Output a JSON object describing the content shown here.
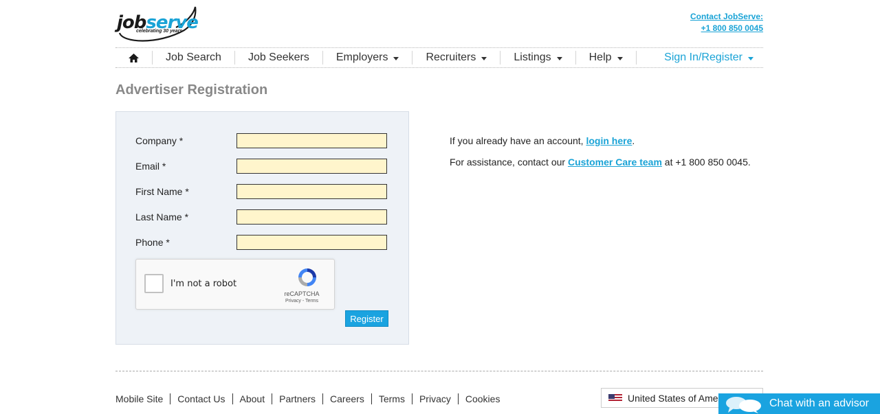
{
  "header": {
    "logo_word_1": "job",
    "logo_word_2": "serve",
    "logo_tagline": "celebrating 30 years",
    "contact_label": "Contact JobServe:",
    "contact_phone": "+1 800 850 0045"
  },
  "nav": {
    "home_icon": "home-icon",
    "items": [
      {
        "label": "Job Search",
        "dropdown": false
      },
      {
        "label": "Job Seekers",
        "dropdown": false
      },
      {
        "label": "Employers",
        "dropdown": true
      },
      {
        "label": "Recruiters",
        "dropdown": true
      },
      {
        "label": "Listings",
        "dropdown": true
      },
      {
        "label": "Help",
        "dropdown": true
      }
    ],
    "signin_label": "Sign In/Register"
  },
  "page": {
    "title": "Advertiser Registration"
  },
  "form": {
    "fields": [
      {
        "label": "Company *",
        "value": ""
      },
      {
        "label": "Email *",
        "value": ""
      },
      {
        "label": "First Name *",
        "value": ""
      },
      {
        "label": "Last Name *",
        "value": ""
      },
      {
        "label": "Phone *",
        "value": ""
      }
    ],
    "captcha_label": "I'm not a robot",
    "captcha_brand": "reCAPTCHA",
    "captcha_links": "Privacy - Terms",
    "register_label": "Register"
  },
  "info": {
    "line1_prefix": "If you already have an account, ",
    "line1_link": "login here",
    "line1_suffix": ".",
    "line2_prefix": "For assistance, contact our ",
    "line2_link": "Customer Care team",
    "line2_suffix": " at +1 800 850 0045."
  },
  "footer": {
    "links": [
      "Mobile Site",
      "Contact Us",
      "About",
      "Partners",
      "Careers",
      "Terms",
      "Privacy",
      "Cookies"
    ],
    "country": "United States of America",
    "chat_label": "Chat with an advisor"
  },
  "colors": {
    "accent": "#1aa3d6",
    "button": "#1aa3e0",
    "input_bg": "#fff5cc",
    "panel_bg": "#eef2f7",
    "heading": "#888888"
  }
}
